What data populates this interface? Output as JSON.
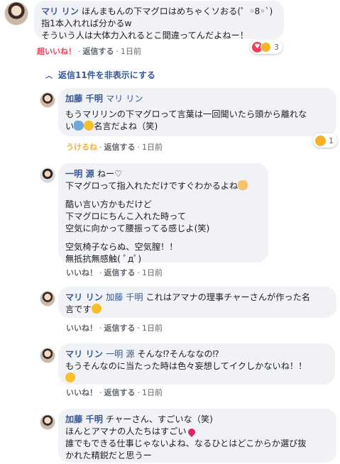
{
  "comment_main": {
    "name": "マリ リン",
    "lines": [
      "ほんまもんの下マグロはめちゃくソおる(゜◦8◦`)",
      "指1本入れれば分かるw",
      "そういう人は大体力入れるとこ間違ってんだよねー！"
    ],
    "like_label": "超いいね！",
    "reply_label": "返信する",
    "time": "1日前",
    "reaction_count": "3"
  },
  "hide_replies": "返信11件を非表示にする",
  "replies": [
    {
      "name": "加藤 千明",
      "mention": "マリ リン",
      "line1": "もうマリリンの下マグロって言葉は一回聞いたら頭から離れな",
      "line2": "い",
      "line2_rest": "名言だよね（笑)",
      "like_label": "うけるね",
      "reply_label": "返信する",
      "time": "1日前",
      "reaction_count": "1"
    },
    {
      "name": "一明 源",
      "first_text": "ねー♡",
      "line1": "下マグロって指入れただけですぐわかるよね",
      "para2": [
        "酷い言い方かもだけど",
        "下マグロにちんこ入れた時って",
        "空気に向かって腰振ってる感じよ(笑)"
      ],
      "para3": [
        "空気椅子ならぬ、空気膣！！",
        "無抵抗無感触( ﾟдﾟ)"
      ],
      "like_label": "いいね！",
      "reply_label": "返信する",
      "time": "1日前"
    },
    {
      "name": "マリ リン",
      "mention": "加藤 千明",
      "text1": "これはアマナの理事チャーさんが作った名",
      "line2": "言です",
      "like_label": "いいね！",
      "reply_label": "返信する",
      "time": "1日前"
    },
    {
      "name": "マリ リン",
      "mention": "一明 源",
      "text1": "そんな⁉︎そんななの⁉︎",
      "line2": "もうそんなのに当たった時は色々妄想してイクしかないね！！",
      "like_label": "いいね！",
      "reply_label": "返信する",
      "time": "1日前"
    },
    {
      "name": "加藤 千明",
      "text1": "チャーさん、すごいな（笑)",
      "line2": "ほんとアマナの人たちはすごい",
      "line3": "誰でもできる仕事じゃないよね、なるひとはどこからか選び抜",
      "line4": "かれた精鋭だと思うー"
    }
  ]
}
